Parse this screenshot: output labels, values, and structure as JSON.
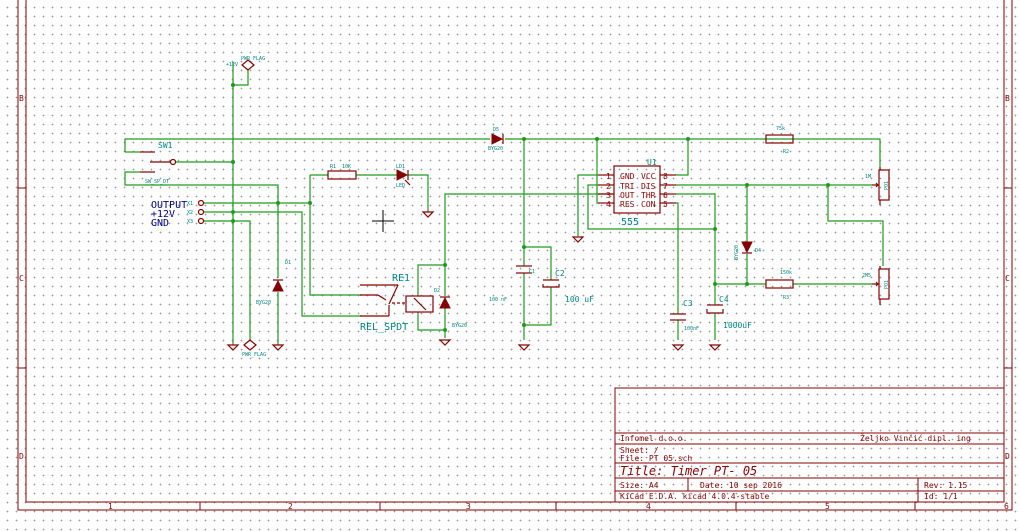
{
  "colors": {
    "wire": "#1e9a1e",
    "component": "#840000",
    "reference": "#008484",
    "label": "#000084",
    "background": "#ffffff"
  },
  "frame": {
    "columns": [
      "1",
      "2",
      "3",
      "4",
      "5",
      "6"
    ],
    "rows": [
      "B",
      "C",
      "D"
    ]
  },
  "power": {
    "plus12v": "+12V",
    "pwr_flag_top": "PWR_FLAG",
    "pwr_flag_bottom": "PWR_FLAG"
  },
  "switch": {
    "ref": "SW1",
    "value": "SW_SP_DT"
  },
  "connector": {
    "labels": [
      "OUTPUT",
      "+12V",
      "GND"
    ],
    "pins": [
      "X1",
      "X2",
      "X3"
    ]
  },
  "components": {
    "r1": {
      "ref": "R1",
      "value": "10K"
    },
    "led": {
      "ref": "LD1",
      "value": "LED"
    },
    "d1": {
      "ref": "D1",
      "value": "BYG20"
    },
    "relay": {
      "ref": "RE1",
      "value": "REL_SPDT"
    },
    "d2": {
      "ref": "D2",
      "value": "BYG20"
    },
    "d5": {
      "ref": "D5",
      "value": "BYG20"
    },
    "c1": {
      "ref": "C1",
      "value": "100 nF"
    },
    "c2": {
      "ref": "C2",
      "value": "100 uF"
    },
    "u1": {
      "ref": "U1",
      "value": "555",
      "pins_left": [
        {
          "num": "1",
          "name": "GND"
        },
        {
          "num": "2",
          "name": "TRI"
        },
        {
          "num": "3",
          "name": "OUT"
        },
        {
          "num": "4",
          "name": "RES"
        }
      ],
      "pins_right": [
        {
          "num": "8",
          "name": "VCC"
        },
        {
          "num": "7",
          "name": "DIS"
        },
        {
          "num": "6",
          "name": "THR"
        },
        {
          "num": "5",
          "name": "CON"
        }
      ]
    },
    "c3": {
      "ref": "C3",
      "value": "100nF"
    },
    "c4": {
      "ref": "C4",
      "value": "1000uF"
    },
    "d4": {
      "ref": "D4",
      "value": "BYG20"
    },
    "r2": {
      "ref": "R2",
      "value": "75k"
    },
    "r3": {
      "ref": "R3",
      "value": "150k"
    },
    "pot1": {
      "ref": "PO1",
      "value": "1M"
    },
    "pot2": {
      "ref": "PO1",
      "value": "2M5"
    }
  },
  "title_block": {
    "company": "Infomel d.o.o.",
    "author": "Željko Vinčić dipl. ing",
    "sheet": "Sheet: /",
    "file": "File: PT_05.sch",
    "title": "Title: Timer PT- 05",
    "size": "Size: A4",
    "date": "Date: 10 sep 2016",
    "rev": "Rev: 1.15",
    "tool": "KiCad E.D.A.  kicad 4.0.4-stable",
    "id": "Id: 1/1"
  }
}
